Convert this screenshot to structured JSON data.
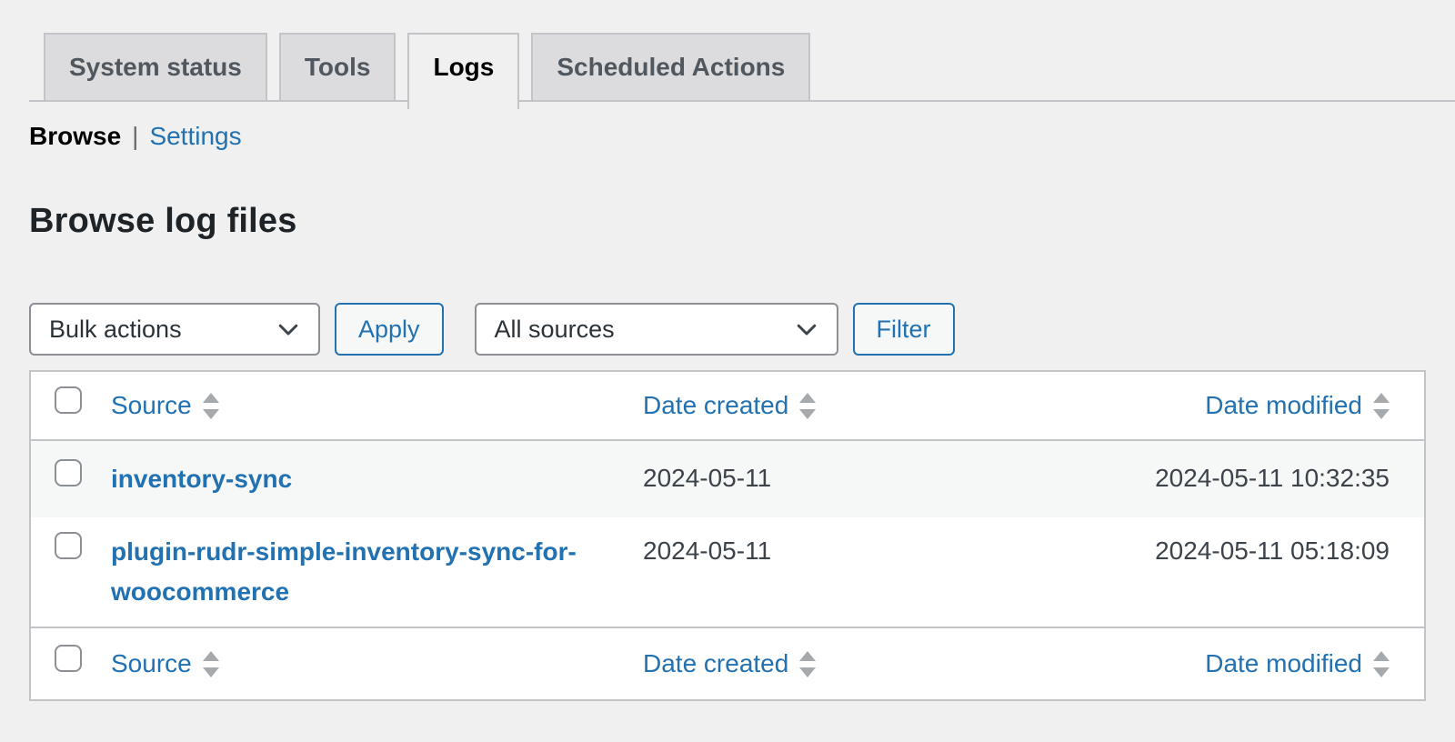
{
  "tabs": {
    "items": [
      {
        "label": "System status",
        "active": false
      },
      {
        "label": "Tools",
        "active": false
      },
      {
        "label": "Logs",
        "active": true
      },
      {
        "label": "Scheduled Actions",
        "active": false
      }
    ]
  },
  "subnav": {
    "current": "Browse",
    "separator": "|",
    "settings_link": "Settings"
  },
  "page_title": "Browse log files",
  "toolbar": {
    "bulk_actions_value": "Bulk actions",
    "apply_label": "Apply",
    "sources_value": "All sources",
    "filter_label": "Filter"
  },
  "table": {
    "headers": {
      "source": "Source",
      "date_created": "Date created",
      "date_modified": "Date modified"
    },
    "rows": [
      {
        "source": "inventory-sync",
        "date_created": "2024-05-11",
        "date_modified": "2024-05-11 10:32:35"
      },
      {
        "source": "plugin-rudr-simple-inventory-sync-for-woocommerce",
        "date_created": "2024-05-11",
        "date_modified": "2024-05-11 05:18:09"
      }
    ]
  },
  "icons": {
    "select_chevron": "chevron-down-icon",
    "sort": "sort-arrows-icon"
  },
  "colors": {
    "page_bg": "#f0f0f1",
    "link": "#2271b1",
    "tab_inactive_bg": "#dcdcde",
    "tab_inactive_text": "#50575e",
    "border": "#c3c4c7",
    "input_border": "#8c8f94",
    "heading_text": "#1d2327",
    "date_text": "#3c434a",
    "row_alt_bg": "#f6f7f7",
    "sort_arrow": "#a7aaad"
  }
}
